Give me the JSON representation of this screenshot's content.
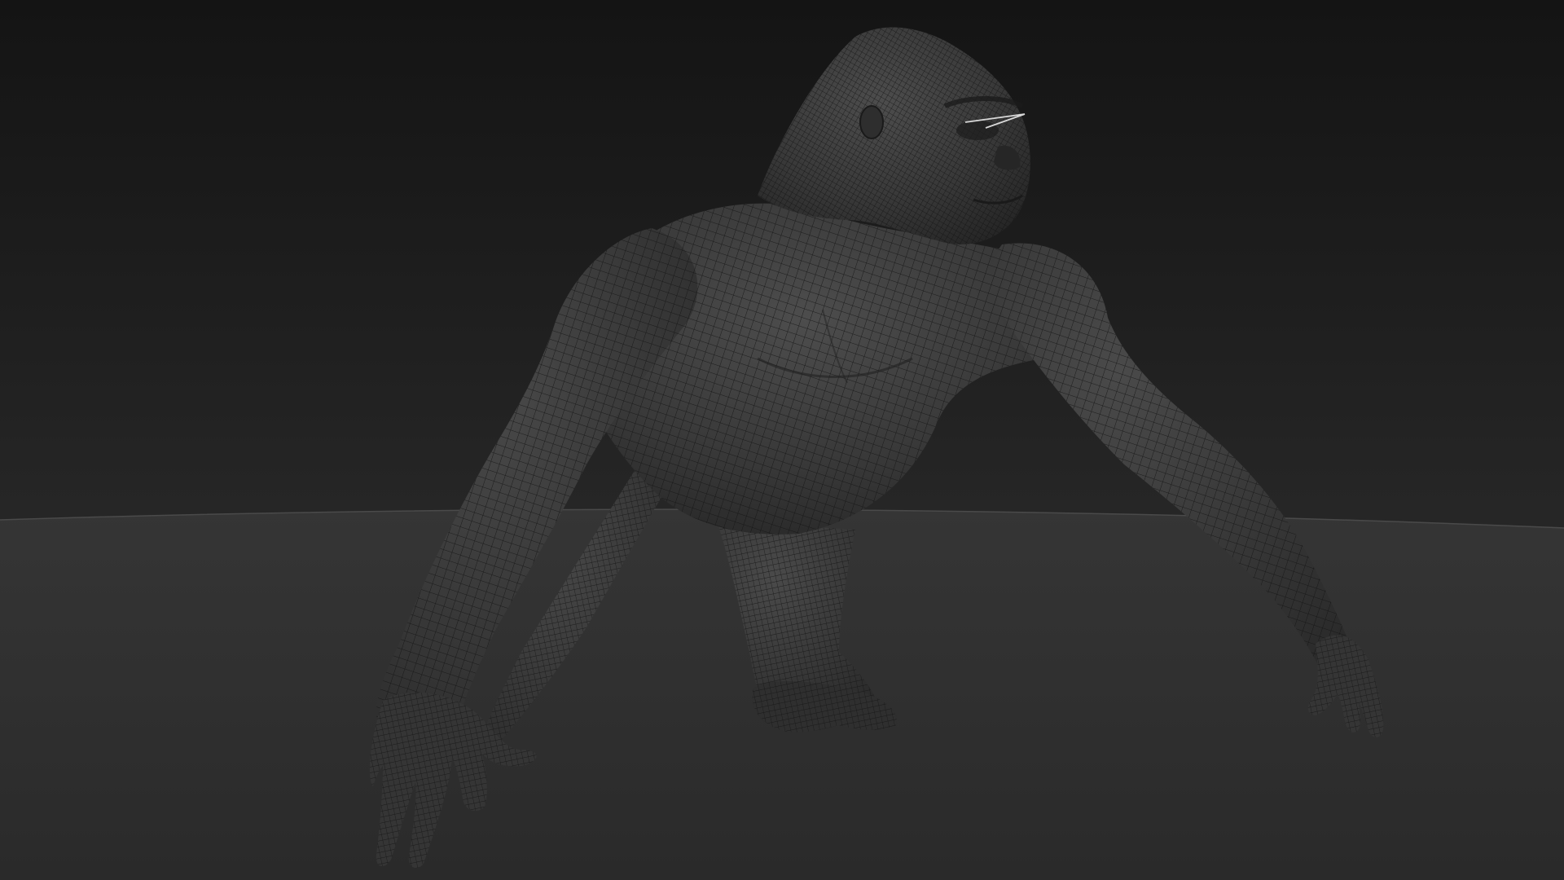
{
  "viewport": {
    "background_top": "#141414",
    "background_bottom": "#2b2b2b",
    "ground_color": "#2e2e2e",
    "ground_horizon_color": "#4a4a4a",
    "model_fill": "#3a3a3a",
    "model_highlight": "#555555",
    "wire_color": "#141414",
    "selection_highlight_color": "#d8d8d8",
    "display_mode": "wireframe-on-shaded",
    "model_subject": "gorilla"
  }
}
